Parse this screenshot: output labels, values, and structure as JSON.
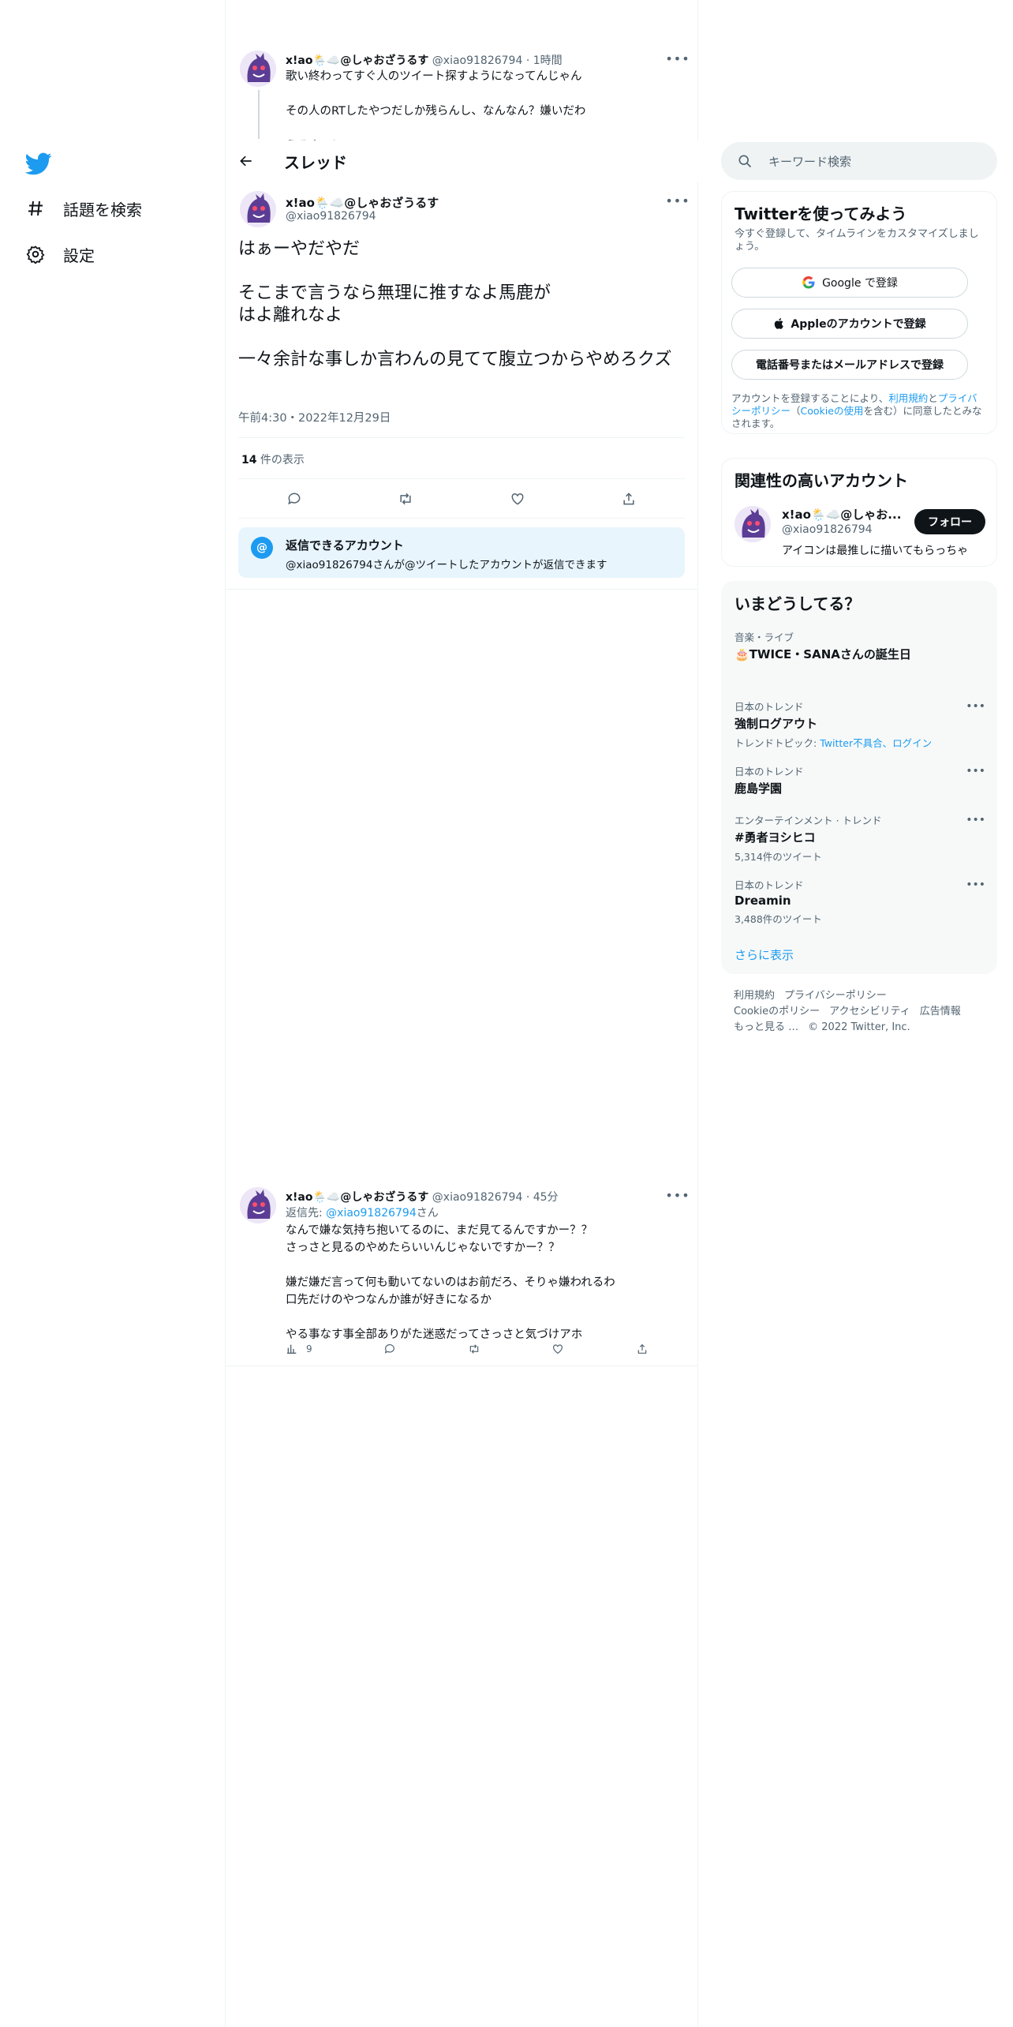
{
  "nav": {
    "logo_icon": "twitter-bird-icon",
    "explore_label": "話題を検索",
    "settings_label": "設定"
  },
  "prev_tweet": {
    "name": "x!ao🌦️☁️@しゃおざうるす",
    "handle_time": "@xiao91826794 · 1時間",
    "text": "歌い終わってすぐ人のツイート探すようになってんじゃん\n\nその人のRTしたやつだしか残らんし、なんなん？嫌いだわ\n\nうるさい！"
  },
  "thread_header": {
    "title": "スレッド"
  },
  "main_tweet": {
    "name": "x!ao🌦️☁️@しゃおざうるす",
    "handle": "@xiao91826794",
    "text": "はぁーやだやだ\n\nそこまで言うなら無理に推すなよ馬鹿が\nはよ離れなよ\n\n一々余計な事しか言わんの見てて腹立つからやめろクズ",
    "datetime": "午前4:30・2022年12月29日",
    "views_count": "14",
    "views_label": " 件の表示"
  },
  "reply_restriction": {
    "title": "返信できるアカウント",
    "text": "@xiao91826794さんが@ツイートしたアカウントが返信できます"
  },
  "reply_tweet": {
    "name": "x!ao🌦️☁️@しゃおざうるす",
    "handle_time": "@xiao91826794 · 45分",
    "reply_to_prefix": "返信先: ",
    "reply_to_handle": "@xiao91826794",
    "reply_to_suffix": "さん",
    "text": "なんで嫌な気持ち抱いてるのに、まだ見てるんですかー？？\nさっさと見るのやめたらいいんじゃないですかー？？\n\n嫌だ嫌だ言って何も動いてないのはお前だろ、そりゃ嫌われるわ\n口先だけのやつなんか誰が好きになるか\n\nやる事なす事全部ありがた迷惑だってさっさと気づけアホ",
    "views": "9"
  },
  "search": {
    "placeholder": "キーワード検索"
  },
  "signup": {
    "title": "Twitterを使ってみよう",
    "subtitle": "今すぐ登録して、タイムラインをカスタマイズしましょう。",
    "google_label": "Google で登録",
    "apple_label": "Appleのアカウントで登録",
    "phone_label": "電話番号またはメールアドレスで登録",
    "legal_1": "アカウントを登録することにより、",
    "legal_terms": "利用規約",
    "legal_2": "と",
    "legal_privacy": "プライバシーポリシー",
    "legal_3": "（",
    "legal_cookie": "Cookieの使用",
    "legal_4": "を含む）に同意したとみなされます。"
  },
  "related": {
    "title": "関連性の高いアカウント",
    "name": "x!ao🌦️☁️@しゃお...",
    "handle": "@xiao91826794",
    "follow_label": "フォロー",
    "bio": "アイコンは最推しに描いてもらっちゃ"
  },
  "trends": {
    "title": "いまどうしてる？",
    "items": [
      {
        "category": "音楽・ライブ",
        "title": "🎂TWICE・SANAさんの誕生日"
      },
      {
        "category": "日本のトレンド",
        "title": "強制ログアウト",
        "meta_prefix": "トレンドトピック: ",
        "meta_link": "Twitter不具合、ログイン"
      },
      {
        "category": "日本のトレンド",
        "title": "鹿島学園"
      },
      {
        "category": "エンターテインメント · トレンド",
        "title": "#勇者ヨシヒコ",
        "meta": "5,314件のツイート"
      },
      {
        "category": "日本のトレンド",
        "title": "Dreamin",
        "meta": "3,488件のツイート"
      }
    ],
    "show_more": "さらに表示"
  },
  "footer": {
    "terms": "利用規約",
    "privacy": "プライバシーポリシー",
    "cookie": "Cookieのポリシー",
    "accessibility": "アクセシビリティ",
    "ads": "広告情報",
    "more": "もっと見る …",
    "copyright": "© 2022 Twitter, Inc."
  },
  "colors": {
    "accent": "#1d9bf0",
    "text": "#0f1419",
    "muted": "#536471",
    "border": "#eff3f4"
  }
}
